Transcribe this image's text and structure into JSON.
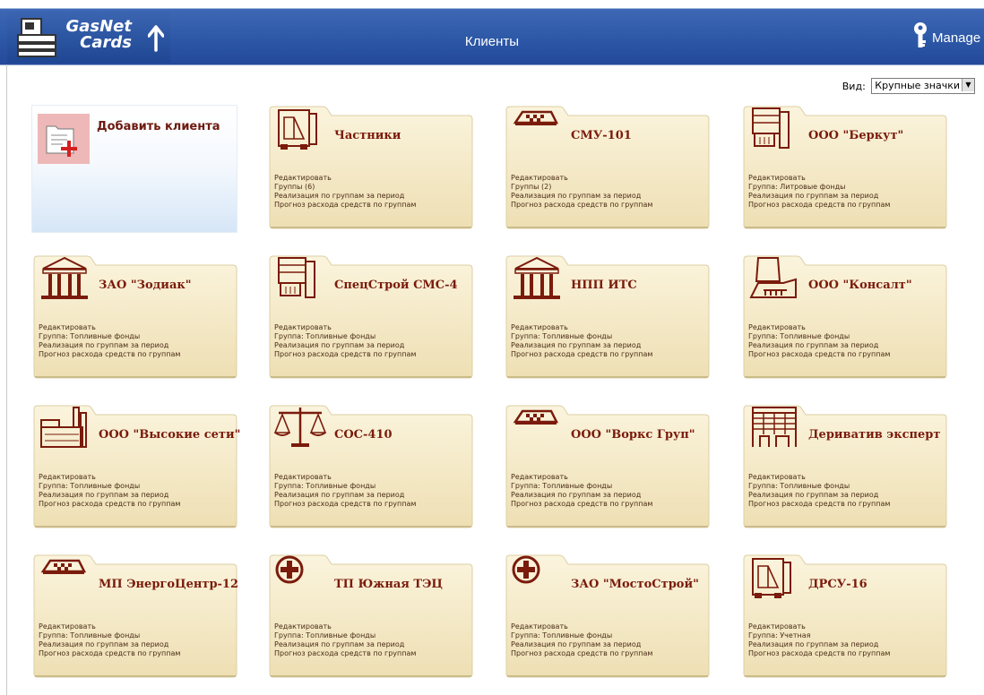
{
  "header": {
    "logo_line1": "GasNet",
    "logo_line2": "Cards",
    "title": "Клиенты",
    "user_label": "Manage"
  },
  "view": {
    "label": "Вид:",
    "selected": "Крупные значки"
  },
  "add_client_label": "Добавить клиента",
  "colors": {
    "header": "#2e5aa8",
    "name_text": "#7a1b0c",
    "card_fill": "#efe2b8"
  },
  "clients": [
    {
      "name": "Частники",
      "icon": "truck-front-icon",
      "links": [
        "Редактировать",
        "Группы (6)",
        "Реализация по группам за период",
        "Прогноз расхода средств по группам"
      ]
    },
    {
      "name": "СМУ-101",
      "icon": "taxi-sign-icon",
      "links": [
        "Редактировать",
        "Группы (2)",
        "Реализация по группам за период",
        "Прогноз расхода средств по группам"
      ]
    },
    {
      "name": "ООО \"Беркут\"",
      "icon": "truck-side-icon",
      "links": [
        "Редактировать",
        "Группа: Литровые фонды",
        "Реализация по группам за период",
        "Прогноз расхода средств по группам"
      ]
    },
    {
      "name": "ЗАО \"Зодиак\"",
      "icon": "columns-building-icon",
      "links": [
        "Редактировать",
        "Группа: Топливные фонды",
        "Реализация по группам за период",
        "Прогноз расхода средств по группам"
      ]
    },
    {
      "name": "СпецСтрой СМС-4",
      "icon": "truck-side-icon",
      "links": [
        "Редактировать",
        "Группа: Топливные фонды",
        "Реализация по группам за период",
        "Прогноз расхода средств по группам"
      ]
    },
    {
      "name": "НПП ИТС",
      "icon": "columns-building-icon",
      "links": [
        "Редактировать",
        "Группа: Топливные фонды",
        "Реализация по группам за период",
        "Прогноз расхода средств по группам"
      ]
    },
    {
      "name": "ООО \"Консалт\"",
      "icon": "power-plant-icon",
      "links": [
        "Редактировать",
        "Группа: Топливные фонды",
        "Реализация по группам за период",
        "Прогноз расхода средств по группам"
      ]
    },
    {
      "name": "ООО \"Высокие сети\"",
      "icon": "factory-icon",
      "links": [
        "Редактировать",
        "Группа: Топливные фонды",
        "Реализация по группам за период",
        "Прогноз расхода средств по группам"
      ]
    },
    {
      "name": "СОС-410",
      "icon": "scales-icon",
      "links": [
        "Редактировать",
        "Группа: Топливные фонды",
        "Реализация по группам за период",
        "Прогноз расхода средств по группам"
      ]
    },
    {
      "name": "ООО \"Воркс Груп\"",
      "icon": "taxi-sign-icon",
      "links": [
        "Редактировать",
        "Группа: Топливные фонды",
        "Реализация по группам за период",
        "Прогноз расхода средств по группам"
      ]
    },
    {
      "name": "Дериватив эксперт",
      "icon": "office-building-icon",
      "links": [
        "Редактировать",
        "Группа: Топливные фонды",
        "Реализация по группам за период",
        "Прогноз расхода средств по группам"
      ]
    },
    {
      "name": "МП ЭнергоЦентр-12",
      "icon": "taxi-sign-icon",
      "links": [
        "Редактировать",
        "Группа: Топливные фонды",
        "Реализация по группам за период",
        "Прогноз расхода средств по группам"
      ]
    },
    {
      "name": "ТП Южная ТЭЦ",
      "icon": "medical-cross-icon",
      "links": [
        "Редактировать",
        "Группа: Топливные фонды",
        "Реализация по группам за период",
        "Прогноз расхода средств по группам"
      ]
    },
    {
      "name": "ЗАО \"МостоСтрой\"",
      "icon": "medical-cross-icon",
      "links": [
        "Редактировать",
        "Группа: Топливные фонды",
        "Реализация по группам за период",
        "Прогноз расхода средств по группам"
      ]
    },
    {
      "name": "ДРСУ-16",
      "icon": "truck-front-icon",
      "links": [
        "Редактировать",
        "Группа: Учетная",
        "Реализация по группам за период",
        "Прогноз расхода средств по группам"
      ]
    }
  ]
}
